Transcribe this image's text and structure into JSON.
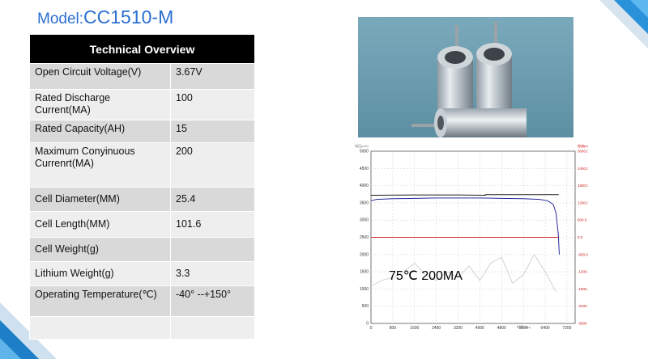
{
  "header": {
    "model_prefix": "Model:",
    "model_name": "CC1510-M"
  },
  "table": {
    "title": "Technical  Overview",
    "rows": [
      {
        "label": "Open Circuit Voltage(V)",
        "value": "3.67V"
      },
      {
        "label": "Rated Discharge Current(MA)",
        "value": "100"
      },
      {
        "label": "Rated Capacity(AH)",
        "value": "15"
      },
      {
        "label": "Maximum Conyinuous Currenrt(MA)",
        "value": "200"
      },
      {
        "label": "Cell Diameter(MM)",
        "value": "25.4"
      },
      {
        "label": "Cell Length(MM)",
        "value": "101.6"
      },
      {
        "label": "Cell Weight(g)",
        "value": ""
      },
      {
        "label": "Lithium Weight(g)",
        "value": "3.3"
      },
      {
        "label": "Operating Temperature(℃)",
        "value": "-40° --+150°"
      },
      {
        "label": "",
        "value": ""
      }
    ]
  },
  "chart_data": {
    "type": "line",
    "annotation": "75℃  200MA",
    "x": {
      "ticks": [
        "0",
        "800",
        "1600",
        "2400",
        "3200",
        "4000",
        "4800",
        "5600",
        "6400",
        "7200"
      ],
      "range": [
        0,
        7500
      ]
    },
    "y_left": {
      "ticks": [
        "0",
        "500",
        "1000",
        "1500",
        "2000",
        "2500",
        "3000",
        "3500",
        "4000",
        "4500",
        "5000"
      ],
      "range": [
        0,
        5000
      ]
    },
    "y_right": {
      "ticks": [
        "3000.0",
        "2400.0",
        "1800.0",
        "1200.0",
        "600.0",
        "0.0",
        "-600.0",
        "-1200.0",
        "-1800.0",
        "-2400.0",
        "-3000"
      ],
      "range": [
        -3000,
        3000
      ]
    },
    "series": [
      {
        "color": "#2b2b9a",
        "x": [
          0,
          200,
          800,
          1600,
          2400,
          3200,
          4000,
          4800,
          5600,
          6200,
          6500,
          6700,
          6800,
          6880,
          6920
        ],
        "y": [
          3560,
          3600,
          3620,
          3630,
          3640,
          3640,
          3640,
          3630,
          3620,
          3600,
          3560,
          3450,
          3200,
          2600,
          2000
        ]
      },
      {
        "color": "#222222",
        "x": [
          0,
          1600,
          3200,
          4200,
          4200,
          6900
        ],
        "y": [
          3720,
          3730,
          3730,
          3720,
          3740,
          3740
        ]
      },
      {
        "color": "#d42b2b",
        "x": [
          0,
          6900
        ],
        "y": [
          0,
          0
        ]
      },
      {
        "color": "#c8c8c8",
        "x": [
          0,
          400,
          800,
          1200,
          1600,
          2000,
          2400,
          2800,
          3200,
          3600,
          4000,
          4400,
          4800,
          5200,
          5600,
          6000,
          6400,
          6800
        ],
        "y": [
          -1700,
          -1500,
          -1400,
          -1200,
          -900,
          -1300,
          -1500,
          -1200,
          -1400,
          -1000,
          -1500,
          -900,
          -700,
          -1600,
          -1300,
          -600,
          -1200,
          -1900
        ]
      }
    ],
    "colors": {
      "voltage": "#2b2b9a",
      "current": "#d42b2b",
      "temperature": "#c8c8c8"
    }
  },
  "colors": {
    "title": "#2a6fd3",
    "header_bg": "#000000",
    "row_odd": "#d9d9d9",
    "row_even": "#eeeeee",
    "accent": "#1e90d6"
  }
}
